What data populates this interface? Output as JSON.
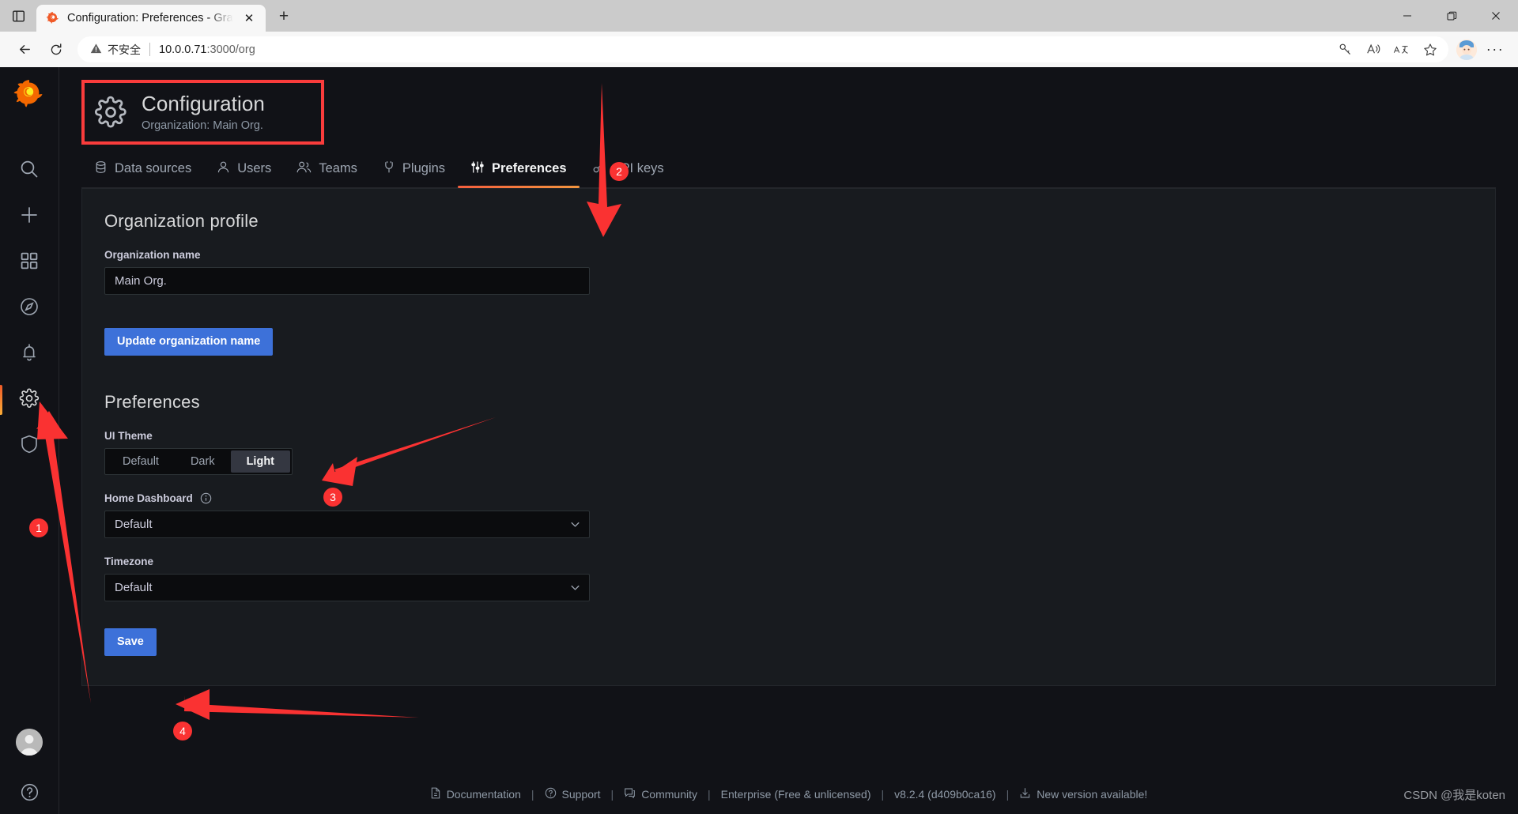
{
  "browser": {
    "tab_title": "Configuration: Preferences - Graf",
    "new_tab_label": "+",
    "close_label": "✕",
    "security_label": "不安全",
    "url_host": "10.0.0.71",
    "url_rest": ":3000/org",
    "minimize_label": "—",
    "maximize_label": "❐",
    "window_close_label": "✕",
    "more_label": "···",
    "icons": {
      "tab_switcher": "tab-switcher-icon",
      "favicon": "grafana-favicon",
      "back": "back-arrow-icon",
      "reload": "reload-icon",
      "warning": "warning-triangle-icon",
      "key": "key-icon",
      "read_aloud": "read-aloud-icon",
      "translate": "translate-icon",
      "favorite": "star-icon",
      "profile": "profile-avatar-icon"
    }
  },
  "sidebar": {
    "logo": "grafana-logo",
    "items": [
      {
        "name": "search",
        "icon": "search-icon",
        "active": false
      },
      {
        "name": "create",
        "icon": "plus-icon",
        "active": false
      },
      {
        "name": "dashboards",
        "icon": "apps-grid-icon",
        "active": false
      },
      {
        "name": "explore",
        "icon": "compass-icon",
        "active": false
      },
      {
        "name": "alerting",
        "icon": "bell-icon",
        "active": false
      },
      {
        "name": "configuration",
        "icon": "gear-icon",
        "active": true
      },
      {
        "name": "server-admin",
        "icon": "shield-icon",
        "active": false
      }
    ],
    "avatar": "user-avatar",
    "help": "help-circle-icon"
  },
  "header": {
    "icon": "gear-icon",
    "title": "Configuration",
    "subtitle": "Organization: Main Org."
  },
  "tabs": [
    {
      "label": "Data sources",
      "icon": "database-icon",
      "active": false
    },
    {
      "label": "Users",
      "icon": "user-icon",
      "active": false
    },
    {
      "label": "Teams",
      "icon": "users-icon",
      "active": false
    },
    {
      "label": "Plugins",
      "icon": "plug-icon",
      "active": false
    },
    {
      "label": "Preferences",
      "icon": "sliders-icon",
      "active": true
    },
    {
      "label": "API keys",
      "icon": "key-icon",
      "active": false
    }
  ],
  "org_profile": {
    "section_title": "Organization profile",
    "name_label": "Organization name",
    "name_value": "Main Org.",
    "update_button": "Update organization name"
  },
  "preferences": {
    "section_title": "Preferences",
    "ui_theme_label": "UI Theme",
    "ui_theme_options": [
      "Default",
      "Dark",
      "Light"
    ],
    "ui_theme_selected": "Light",
    "home_dashboard_label": "Home Dashboard",
    "home_dashboard_info_icon": "info-circle-icon",
    "home_dashboard_value": "Default",
    "timezone_label": "Timezone",
    "timezone_value": "Default",
    "save_button": "Save"
  },
  "footer": {
    "items": [
      {
        "label": "Documentation",
        "icon": "doc-icon"
      },
      {
        "label": "Support",
        "icon": "question-circle-icon"
      },
      {
        "label": "Community",
        "icon": "comment-icon"
      },
      {
        "label": "Enterprise (Free & unlicensed)",
        "icon": ""
      },
      {
        "label": "v8.2.4 (d409b0ca16)",
        "icon": ""
      },
      {
        "label": "New version available!",
        "icon": "download-icon"
      }
    ],
    "separator": "|"
  },
  "watermark": "CSDN @我是koten",
  "annotations": {
    "colors": {
      "marker": "#fa3232",
      "highlight_box": "#fa3c3c"
    },
    "markers": [
      {
        "id": "1",
        "label": "1"
      },
      {
        "id": "2",
        "label": "2"
      },
      {
        "id": "3",
        "label": "3"
      },
      {
        "id": "4",
        "label": "4"
      }
    ]
  }
}
